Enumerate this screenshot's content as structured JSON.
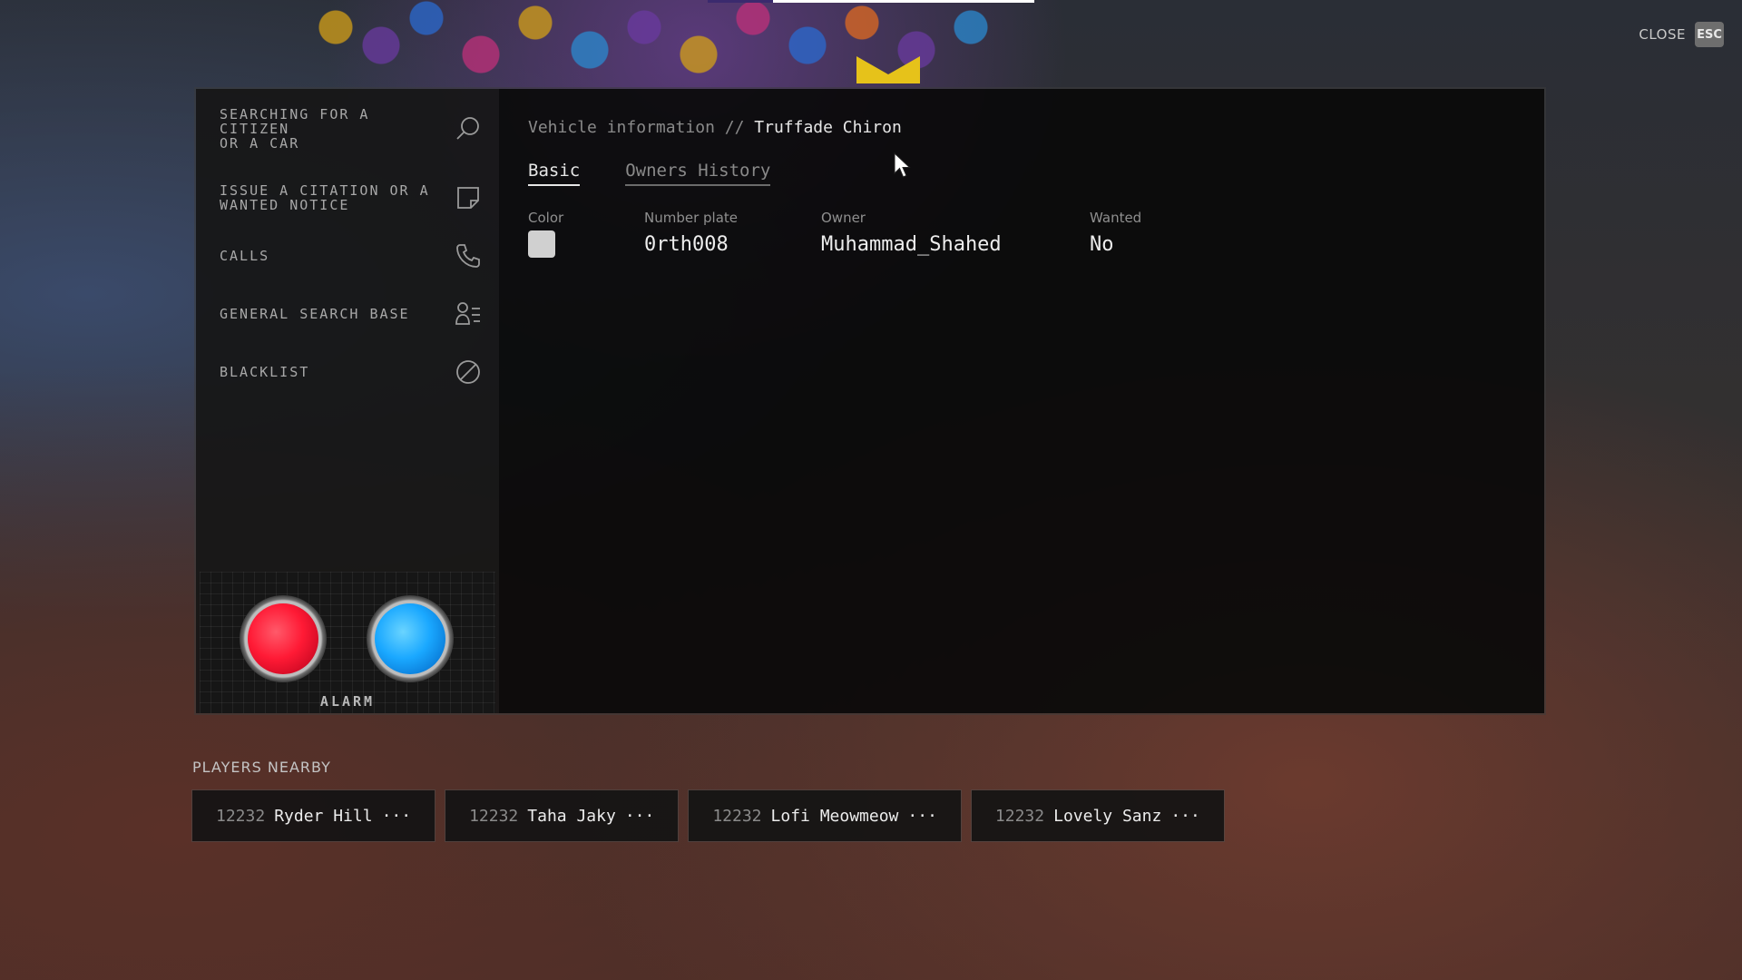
{
  "hud": {
    "close_label": "CLOSE",
    "close_key": "ESC",
    "top_progress": 0.2
  },
  "sidebar": {
    "items": [
      {
        "label": "SEARCHING FOR A CITIZEN\nOR A CAR",
        "icon": "search-icon"
      },
      {
        "label": "ISSUE A CITATION OR A\nWANTED NOTICE",
        "icon": "note-icon"
      },
      {
        "label": "CALLS",
        "icon": "phone-icon"
      },
      {
        "label": "GENERAL SEARCH BASE",
        "icon": "user-list-icon"
      },
      {
        "label": "BLACKLIST",
        "icon": "block-icon"
      }
    ],
    "alarm_label": "ALARM",
    "alarm_colors": {
      "red": "#ff1a35",
      "blue": "#1aa8ff"
    }
  },
  "main": {
    "breadcrumb_section": "Vehicle information //",
    "breadcrumb_current": "Truffade Chiron",
    "tabs": [
      {
        "label": "Basic",
        "active": true
      },
      {
        "label": "Owners History",
        "active": false
      }
    ],
    "fields": {
      "color_label": "Color",
      "color_value": "#d0d0d0",
      "plate_label": "Number plate",
      "plate_value": "0rth008",
      "owner_label": "Owner",
      "owner_value": "Muhammad_Shahed",
      "wanted_label": "Wanted",
      "wanted_value": "No"
    }
  },
  "nearby": {
    "title": "PLAYERS NEARBY",
    "players": [
      {
        "id": "12232",
        "name": "Ryder Hill",
        "menu": "···"
      },
      {
        "id": "12232",
        "name": "Taha Jaky",
        "menu": "···"
      },
      {
        "id": "12232",
        "name": "Lofi Meowmeow",
        "menu": "···"
      },
      {
        "id": "12232",
        "name": "Lovely Sanz",
        "menu": "···"
      }
    ]
  },
  "colors": {
    "panel_bg": "#0a0a0a",
    "sidebar_bg": "#161616",
    "emblem": "#e6c21a"
  }
}
